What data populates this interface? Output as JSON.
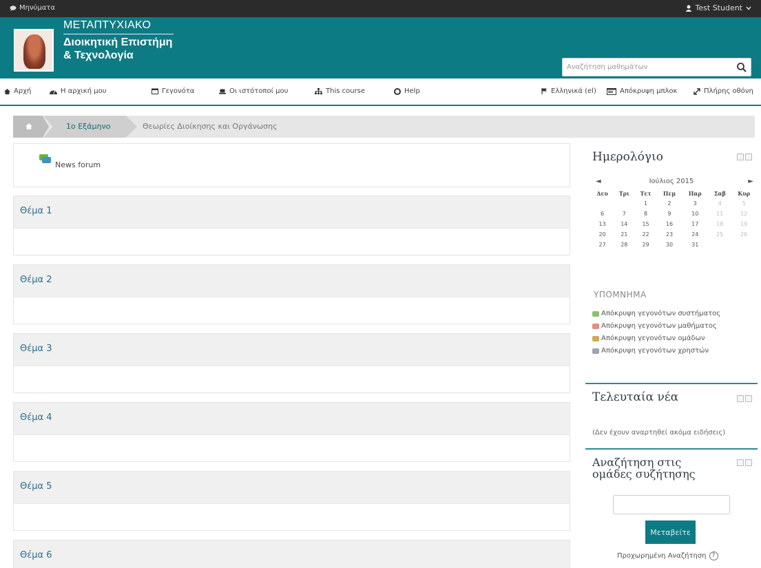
{
  "topbar": {
    "messages_label": "Μηνύματα",
    "user_label": "Test Student"
  },
  "header": {
    "title_line1": "ΜΕΤΑΠΤΥΧΙΑΚΟ",
    "title_line2": "Διοικητική Επιστήμη",
    "title_line3": "& Τεχνολογία",
    "search_placeholder": "Αναζήτηση μαθημάτων"
  },
  "nav": {
    "items": [
      {
        "label": "Αρχή",
        "icon": "home-icon"
      },
      {
        "label": "Η αρχική μου",
        "icon": "dashboard-icon"
      },
      {
        "label": "Γεγονότα",
        "icon": "calendar-icon"
      },
      {
        "label": "Οι ιστότοποί μου",
        "icon": "laptop-icon"
      },
      {
        "label": "This course",
        "icon": "sitemap-icon"
      },
      {
        "label": "Help",
        "icon": "lifebuoy-icon"
      }
    ],
    "language": "Ελληνικά (el)",
    "hide_blocks": "Απόκρυψη μπλοκ",
    "fullscreen": "Πλήρης οθόνη"
  },
  "breadcrumb": {
    "semester": "1ο Εξάμηνο",
    "course": "Θεωρίες Διοίκησης και Οργάνωσης"
  },
  "main": {
    "news_forum": "News forum",
    "topics": [
      "Θέμα 1",
      "Θέμα 2",
      "Θέμα 3",
      "Θέμα 4",
      "Θέμα 5",
      "Θέμα 6"
    ]
  },
  "calendar": {
    "title": "Ημερολόγιο",
    "prev": "◄",
    "next": "►",
    "month": "Ιούλιος 2015",
    "days": [
      "Δευ",
      "Τρι",
      "Τετ",
      "Πεμ",
      "Παρ",
      "Σαβ",
      "Κυρ"
    ],
    "weeks": [
      [
        "",
        "",
        "1",
        "2",
        "3",
        "4",
        "5"
      ],
      [
        "6",
        "7",
        "8",
        "9",
        "10",
        "11",
        "12"
      ],
      [
        "13",
        "14",
        "15",
        "16",
        "17",
        "18",
        "19"
      ],
      [
        "20",
        "21",
        "22",
        "23",
        "24",
        "25",
        "26"
      ],
      [
        "27",
        "28",
        "29",
        "30",
        "31",
        "",
        ""
      ]
    ],
    "legend_title": "ΥΠΟΜΝΗΜΑ",
    "legend": [
      {
        "label": "Απόκρυψη γεγονότων συστήματος",
        "color": "#8cbf6e"
      },
      {
        "label": "Απόκρυψη γεγονότων μαθήματος",
        "color": "#e58c7a"
      },
      {
        "label": "Απόκρυψη γεγονότων ομάδων",
        "color": "#d9a654"
      },
      {
        "label": "Απόκρυψη γεγονότων χρηστών",
        "color": "#9aa7b4"
      }
    ]
  },
  "latest_news": {
    "title": "Τελευταία νέα",
    "empty": "(Δεν έχουν αναρτηθεί ακόμα ειδήσεις)"
  },
  "forum_search": {
    "title": "Αναζήτηση στις ομάδες συζήτησης",
    "button": "Μεταβείτε",
    "advanced": "Προχωρημένη Αναζήτηση"
  },
  "colors": {
    "brand": "#0d7b84",
    "topbar": "#2b2b2b",
    "topic_title": "#2a6f8e"
  }
}
